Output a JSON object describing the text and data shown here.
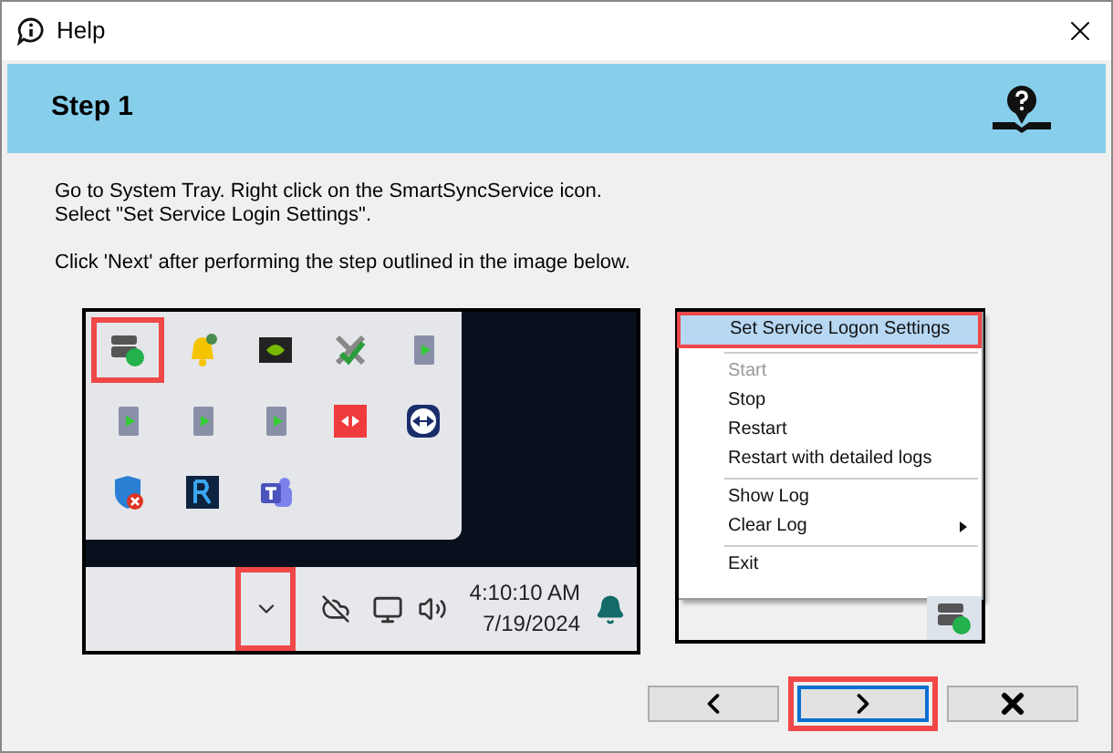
{
  "window": {
    "title": "Help"
  },
  "header": {
    "title": "Step 1"
  },
  "instructions": [
    "Go to System Tray. Right click on the SmartSyncService icon.",
    "Select \"Set Service Login Settings\".",
    "Click 'Next' after performing the step outlined in the image below."
  ],
  "tray_screenshot": {
    "icons": [
      {
        "kind": "server",
        "highlighted": true
      },
      {
        "kind": "bell",
        "highlighted": false
      },
      {
        "kind": "gpu",
        "highlighted": false
      },
      {
        "kind": "tools",
        "highlighted": false
      },
      {
        "kind": "door",
        "highlighted": false
      },
      {
        "kind": "door",
        "highlighted": false
      },
      {
        "kind": "door",
        "highlighted": false
      },
      {
        "kind": "door",
        "highlighted": false
      },
      {
        "kind": "remote",
        "highlighted": false
      },
      {
        "kind": "viewer",
        "highlighted": false
      },
      {
        "kind": "shield",
        "highlighted": false
      },
      {
        "kind": "reader",
        "highlighted": false
      },
      {
        "kind": "teams",
        "highlighted": false
      }
    ],
    "overflow_highlighted": true,
    "time": "4:10:10 AM",
    "date": "7/19/2024"
  },
  "menu_screenshot": {
    "items": [
      {
        "kind": "item",
        "label": "Set Service Logon Settings",
        "selected": true,
        "disabled": false
      },
      {
        "kind": "separator"
      },
      {
        "kind": "item",
        "label": "Start",
        "selected": false,
        "disabled": true
      },
      {
        "kind": "item",
        "label": "Stop",
        "selected": false,
        "disabled": false
      },
      {
        "kind": "item",
        "label": "Restart",
        "selected": false,
        "disabled": false
      },
      {
        "kind": "item",
        "label": "Restart with detailed logs",
        "selected": false,
        "disabled": false
      },
      {
        "kind": "separator"
      },
      {
        "kind": "item",
        "label": "Show Log",
        "selected": false,
        "disabled": false
      },
      {
        "kind": "submenu",
        "label": "Clear Log",
        "selected": false,
        "disabled": false
      },
      {
        "kind": "separator"
      },
      {
        "kind": "item",
        "label": "Exit",
        "selected": false,
        "disabled": false
      }
    ]
  },
  "buttons": [
    {
      "kind": "back",
      "focused": false,
      "highlighted": false
    },
    {
      "kind": "next",
      "focused": true,
      "highlighted": true
    },
    {
      "kind": "close",
      "focused": false,
      "highlighted": false
    }
  ]
}
